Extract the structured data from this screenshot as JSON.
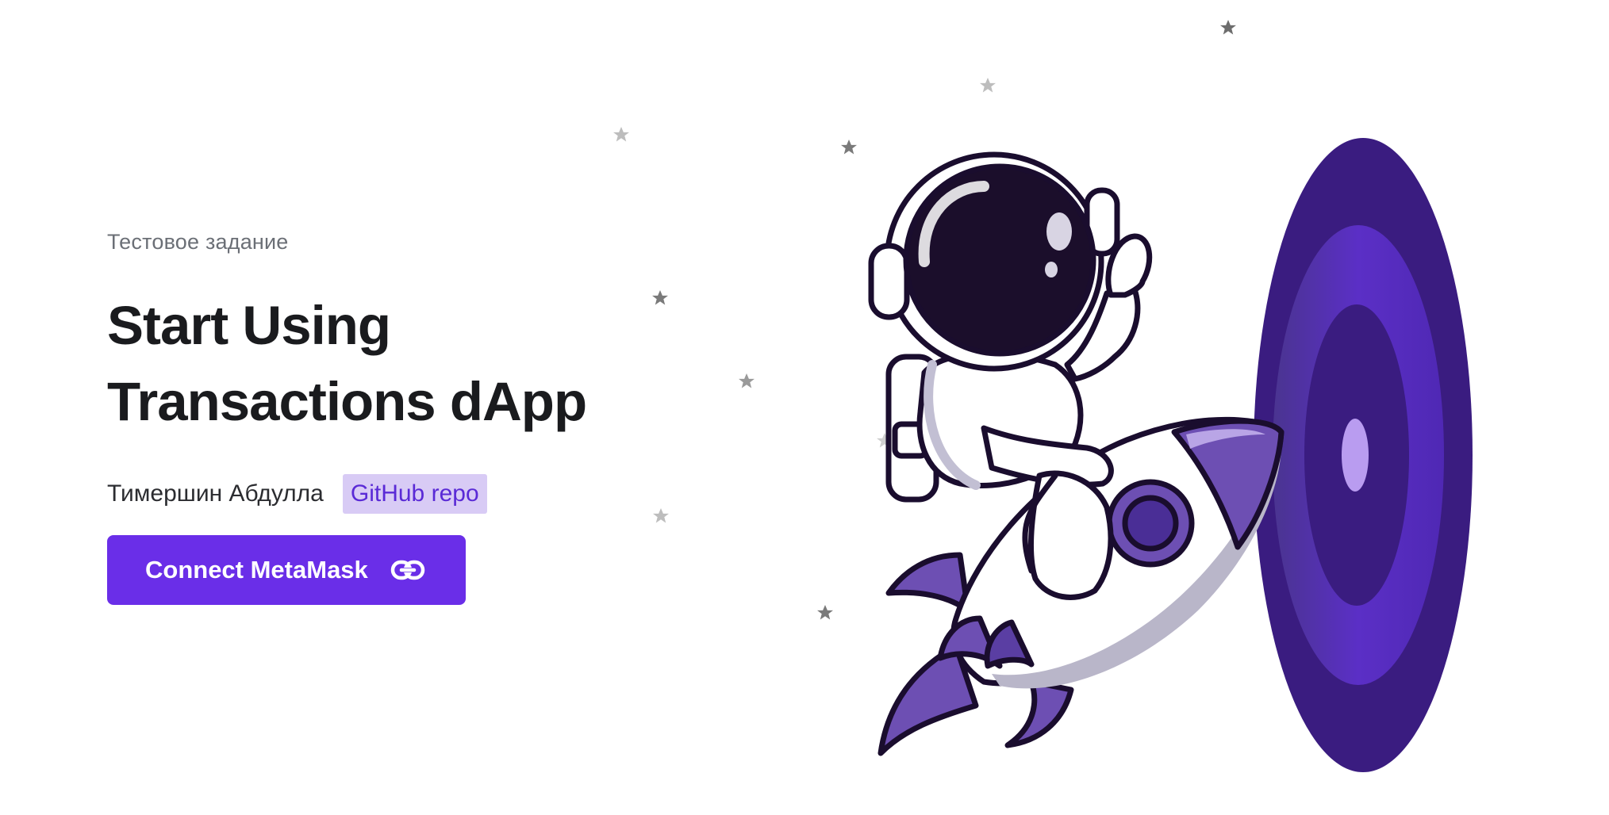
{
  "hero": {
    "eyebrow": "Тестовое задание",
    "title_line1": "Start Using",
    "title_line2": "Transactions dApp",
    "author": "Тимершин Абдулла",
    "repo_link_label": "GitHub repo",
    "connect_button_label": "Connect MetaMask",
    "connect_button_icon": "link-icon"
  },
  "illustration": {
    "subject": "astronaut-riding-rocket",
    "portal": "purple-portal",
    "decor": "stars"
  },
  "colors": {
    "accent": "#6a2ee8",
    "link_bg": "#d8cbf5",
    "link_text": "#5a2ad6",
    "title": "#1a1b1e",
    "muted": "#6b6f76",
    "portal_dark": "#3b1d82",
    "portal_mid": "#5a2fc4",
    "portal_light": "#b89cf0"
  }
}
